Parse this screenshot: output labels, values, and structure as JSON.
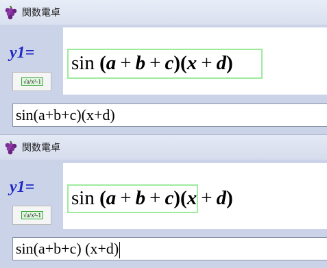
{
  "colors": {
    "label": "#1E27C8",
    "highlight": "#9DEB9D",
    "panel": "#CBD3E8"
  },
  "windows": [
    {
      "title": "関数電卓",
      "icon": "grapes-app-icon",
      "function_label": "y1=",
      "editor_button": {
        "icon": "sqrt-formula-icon",
        "text": "√a/x²-1"
      },
      "formula": {
        "func": "sin",
        "group1": {
          "open": "(",
          "v1": "a",
          "op1": "+",
          "v2": "b",
          "op2": "+",
          "v3": "c",
          "close": ")"
        },
        "group2": {
          "open": "(",
          "v1": "x",
          "op1": "+",
          "v2": "d",
          "close": ")"
        }
      },
      "input_value": "sin(a+b+c)(x+d)"
    },
    {
      "title": "関数電卓",
      "icon": "grapes-app-icon",
      "function_label": "y1=",
      "editor_button": {
        "icon": "sqrt-formula-icon",
        "text": "√a/x²-1"
      },
      "formula": {
        "func": "sin",
        "group1": {
          "open": "(",
          "v1": "a",
          "op1": "+",
          "v2": "b",
          "op2": "+",
          "v3": "c",
          "close": ")"
        },
        "group2": {
          "open": "(",
          "v1": "x",
          "op1": "+",
          "v2": "d",
          "close": ")"
        }
      },
      "input_value": "sin(a+b+c) (x+d)"
    }
  ]
}
